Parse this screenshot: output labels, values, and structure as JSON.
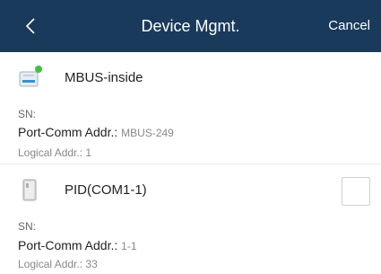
{
  "header": {
    "title": "Device Mgmt.",
    "cancel_label": "Cancel",
    "back_icon": "chevron-left-icon"
  },
  "devices": [
    {
      "name": "MBUS-inside",
      "icon": "mbus-device-icon",
      "status_color": "#3cc43c",
      "sn_label": "SN:",
      "sn_value": "",
      "port_label": "Port-Comm Addr.:",
      "port_value": "MBUS-249",
      "logical_label": "Logical Addr.:",
      "logical_value": "1"
    },
    {
      "name": "PID(COM1-1)",
      "icon": "pid-device-icon",
      "sn_label": "SN:",
      "sn_value": "",
      "port_label": "Port-Comm Addr.:",
      "port_value": "1-1",
      "logical_label": "Logical Addr.:",
      "logical_value": "33",
      "checked": false
    }
  ],
  "colors": {
    "header_bg": "#1a3a5c",
    "header_text": "#ffffff",
    "status_online": "#3cc43c"
  }
}
